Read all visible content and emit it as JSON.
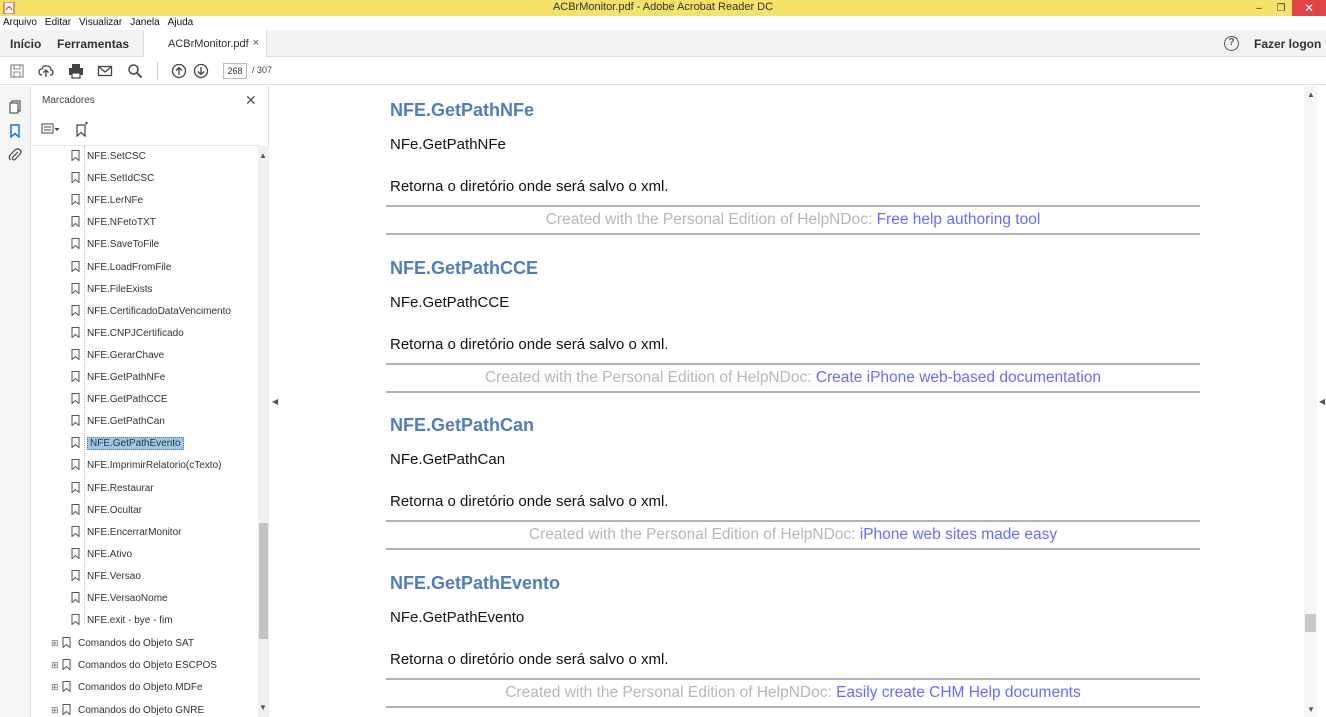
{
  "window": {
    "title": "ACBrMonitor.pdf - Adobe Acrobat Reader DC",
    "minimize": "–",
    "restore": "❐",
    "close": "✕"
  },
  "menu": [
    "Arquivo",
    "Editar",
    "Visualizar",
    "Janela",
    "Ajuda"
  ],
  "tabs": {
    "home": "Início",
    "tools": "Ferramentas",
    "document": "ACBrMonitor.pdf",
    "close": "×",
    "help": "?",
    "login": "Fazer logon"
  },
  "toolbar": {
    "current_page": "268",
    "total_pages": "/ 307"
  },
  "panel": {
    "title": "Marcadores",
    "close": "✕",
    "bookmarks": [
      "NFE.SetCSC",
      "NFE.SetIdCSC",
      "NFE.LerNFe",
      "NFE.NFetoTXT",
      "NFE.SaveToFile",
      "NFE.LoadFromFile",
      "NFE.FileExists",
      "NFE.CertificadoDataVencimento",
      "NFE.CNPJCertificado",
      "NFE.GerarChave",
      "NFE.GetPathNFe",
      "NFE.GetPathCCE",
      "NFE.GetPathCan",
      "NFE.GetPathEvento",
      "NFE.ImprimirRelatorio(cTexto)",
      "NFE.Restaurar",
      "NFE.Ocultar",
      "NFE.EncerrarMonitor",
      "NFE.Ativo",
      "NFE.Versao",
      "NFE.VersaoNome",
      "NFE.exit - bye - fim"
    ],
    "selected_index": 13,
    "groups": [
      "Comandos do Objeto SAT",
      "Comandos do Objeto ESCPOS",
      "Comandos do Objeto MDFe",
      "Comandos do Objeto GNRE"
    ],
    "expander": "⊞"
  },
  "document": {
    "credit_prefix": "Created with the Personal Edition of HelpNDoc:",
    "sections": [
      {
        "title": "NFE.GetPathNFe",
        "code": "NFe.GetPathNFe",
        "description": "Retorna o diretório onde será salvo o xml.",
        "credit_link": "Free help authoring tool"
      },
      {
        "title": "NFE.GetPathCCE",
        "code": "NFe.GetPathCCE",
        "description": "Retorna o diretório onde será salvo o xml.",
        "credit_link": "Create iPhone web-based documentation"
      },
      {
        "title": "NFE.GetPathCan",
        "code": "NFe.GetPathCan",
        "description": "Retorna o diretório onde será salvo o xml.",
        "credit_link": "iPhone web sites made easy"
      },
      {
        "title": "NFE.GetPathEvento",
        "code": "NFe.GetPathEvento",
        "description": "Retorna o diretório onde será salvo o xml.",
        "credit_link": "Easily create CHM Help documents"
      }
    ]
  },
  "colors": {
    "titlebar": "#f4e26a",
    "heading": "#4f7eb8",
    "link": "#6a6aff",
    "selection": "#9ec8e8"
  }
}
